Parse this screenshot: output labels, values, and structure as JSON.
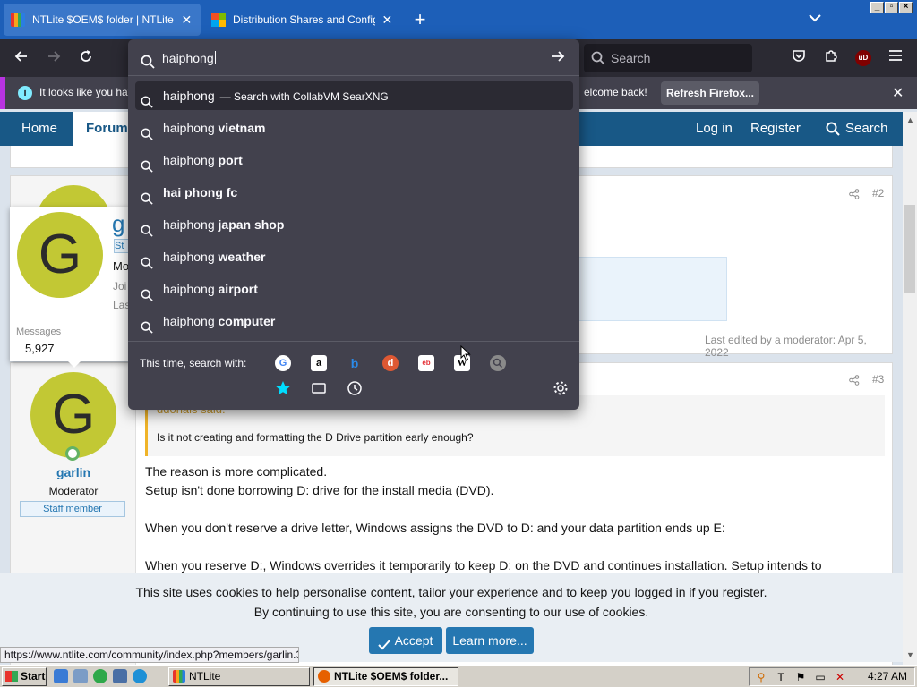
{
  "tabs": [
    {
      "title": "NTLite $OEM$ folder | NTLite Forum",
      "active": true
    },
    {
      "title": "Distribution Shares and Configuration",
      "active": false
    }
  ],
  "nav": {
    "search_placeholder": "Search"
  },
  "notification": {
    "message_left": "It looks like you have",
    "message_right": "elcome back!",
    "button": "Refresh Firefox..."
  },
  "site_nav": {
    "home": "Home",
    "forums": "Forums",
    "login": "Log in",
    "register": "Register",
    "search": "Search"
  },
  "urlbar": {
    "value": "haiphong",
    "suggestions": [
      {
        "prefix": "haiphong",
        "suffix": "",
        "engine": "— Search with CollabVM SearXNG"
      },
      {
        "prefix": "haiphong ",
        "suffix": "vietnam",
        "engine": ""
      },
      {
        "prefix": "haiphong ",
        "suffix": "port",
        "engine": ""
      },
      {
        "prefix": "",
        "suffix": "hai phong fc",
        "engine": ""
      },
      {
        "prefix": "haiphong ",
        "suffix": "japan shop",
        "engine": ""
      },
      {
        "prefix": "haiphong ",
        "suffix": "weather",
        "engine": ""
      },
      {
        "prefix": "haiphong ",
        "suffix": "airport",
        "engine": ""
      },
      {
        "prefix": "haiphong ",
        "suffix": "computer",
        "engine": ""
      }
    ],
    "oneoff_label": "This time, search with:",
    "engines": [
      "google",
      "amazon",
      "bing",
      "duckduckgo",
      "ebay",
      "wikipedia",
      "searxng"
    ],
    "modes": [
      "bookmarks",
      "tabs",
      "history"
    ]
  },
  "posts": [
    {
      "number": "#2",
      "edited": "Last edited by a moderator: Apr 5, 2022"
    },
    {
      "number": "#3",
      "author": "garlin",
      "role": "Moderator",
      "badge": "Staff member",
      "avatar_letter": "G",
      "quote_author": "ddonals said:",
      "quote_text": "Is it not creating and formatting the D Drive partition early enough?",
      "paragraphs": [
        "The reason is more complicated.",
        "Setup isn't done borrowing D: drive for the install media (DVD).",
        "When you don't reserve a drive letter, Windows assigns the DVD to D: and your data partition ends up E:",
        "When you reserve D:, Windows overrides it temporarily to keep D: on the DVD and continues installation. Setup intends to"
      ]
    }
  ],
  "member_card": {
    "avatar_letter": "G",
    "name_partial": "g",
    "badge_partial": "St",
    "role_partial": "Mo",
    "joined_partial": "Joi",
    "last_partial": "Las",
    "messages_label": "Messages",
    "messages_value": "5,927"
  },
  "cookie": {
    "line1": "This site uses cookies to help personalise content, tailor your experience and to keep you logged in if you register.",
    "line2": "By continuing to use this site, you are consenting to our use of cookies.",
    "accept": "Accept",
    "learn_more": "Learn more..."
  },
  "status_url": "https://www.ntlite.com/community/index.php?members/garlin.3137/",
  "taskbar": {
    "start": "Start",
    "tasks": [
      {
        "label": "NTLite",
        "active": false
      },
      {
        "label": "NTLite $OEM$ folder...",
        "active": true
      }
    ],
    "clock": "4:27 AM"
  },
  "colors": {
    "tabstrip": "#1d5fb8",
    "toolbar": "#2b2a33",
    "urlpanel": "#42414d",
    "site_nav": "#185886",
    "avatar": "#c2c834",
    "accent_blue": "#2577b1"
  }
}
